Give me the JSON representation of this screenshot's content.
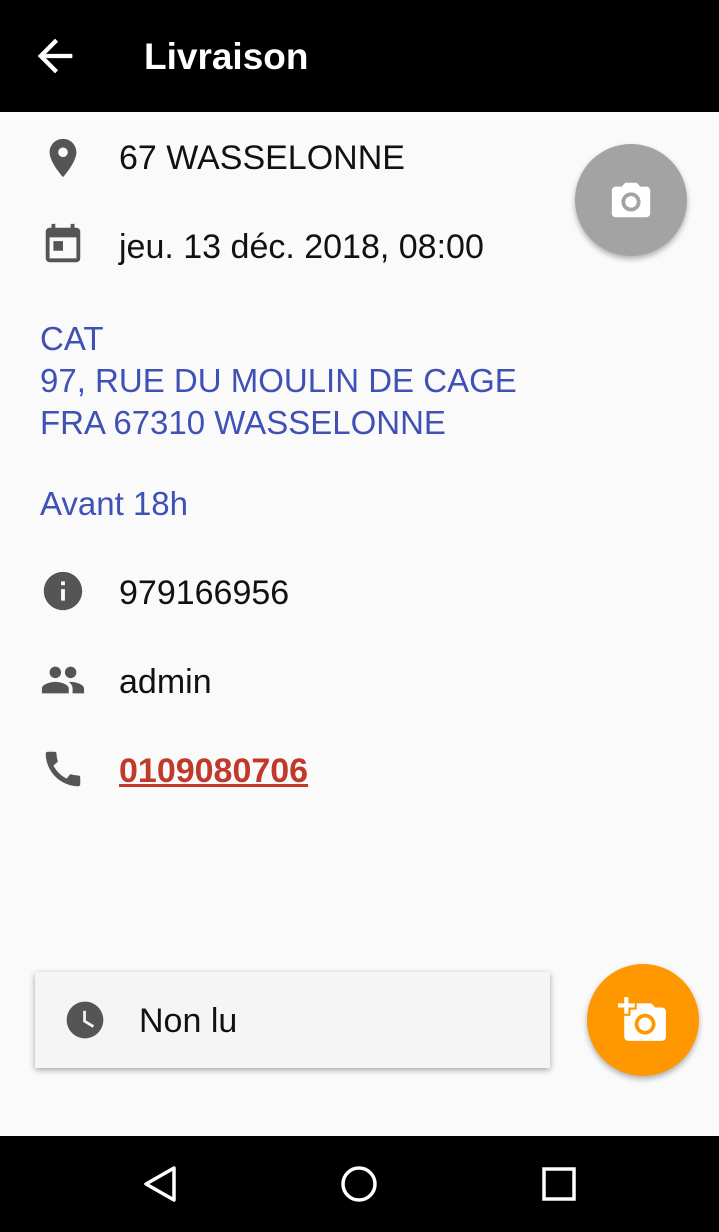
{
  "header": {
    "title": "Livraison",
    "back_icon": "arrow-back-icon"
  },
  "details": {
    "location": "67 WASSELONNE",
    "datetime": "jeu. 13 déc. 2018, 08:00",
    "address_lines": [
      "CAT",
      "97, RUE DU MOULIN DE CAGE",
      "FRA 67310 WASSELONNE"
    ],
    "note": "Avant 18h",
    "reference": "979166956",
    "user": "admin",
    "phone": "0109080706"
  },
  "status": {
    "label": "Non lu",
    "icon": "clock-icon"
  },
  "colors": {
    "accent": "#3f51b5",
    "phone": "#c0392b",
    "fab_orange": "#ff9800",
    "fab_gray": "#a3a3a3"
  },
  "nav": {
    "back_icon": "nav-back-icon",
    "home_icon": "nav-home-icon",
    "recents_icon": "nav-recents-icon"
  }
}
